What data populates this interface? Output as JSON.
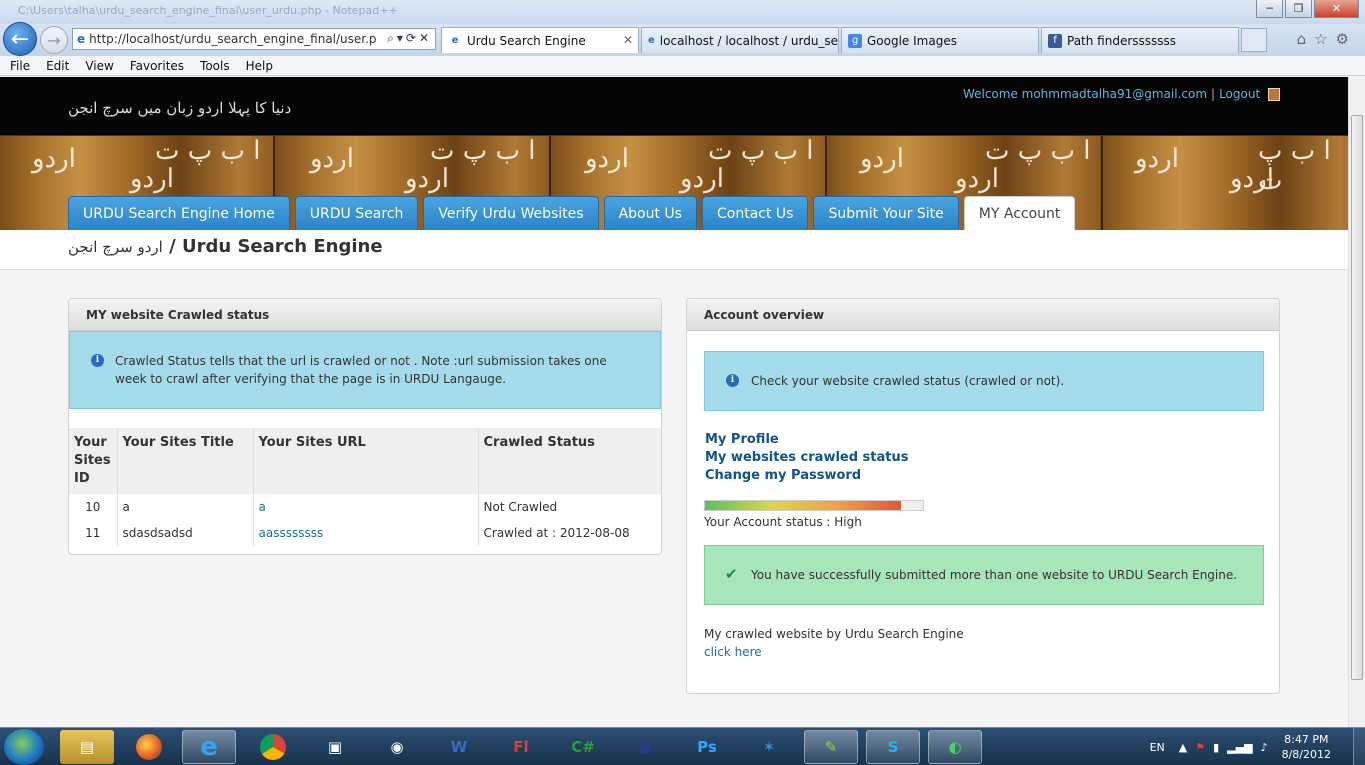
{
  "browser": {
    "title_text": "C:\\Users\\talha\\urdu_search_engine_final\\user_urdu.php - Notepad++",
    "address": "http://localhost/urdu_search_engine_final/user.p",
    "tabs": [
      {
        "label": "Urdu Search Engine",
        "active": true
      },
      {
        "label": "localhost / localhost / urdu_se...",
        "active": false
      },
      {
        "label": "Google Images",
        "active": false
      },
      {
        "label": "Path findersssssss",
        "active": false
      }
    ],
    "menu": [
      "File",
      "Edit",
      "View",
      "Favorites",
      "Tools",
      "Help"
    ]
  },
  "site": {
    "tagline": "دنیا کا پہلا اردو زبان میں سرچ انجن",
    "welcome": "Welcome mohmmadtalha91@gmail.com",
    "logout": "Logout",
    "banner_text": [
      "ا ب پ ت",
      "اردو"
    ],
    "nav": [
      "URDU Search Engine Home",
      "URDU Search",
      "Verify Urdu Websites",
      "About Us",
      "Contact Us",
      "Submit Your Site",
      "MY Account"
    ],
    "breadcrumb_urdu": "اردو سرچ انجن",
    "breadcrumb_sep": "/",
    "breadcrumb_title": "Urdu Search Engine"
  },
  "crawl_panel": {
    "title": "MY website Crawled status",
    "info": "Crawled Status tells that the url is crawled or not . Note :url submission takes one week to crawl after verifying that the page is in URDU Langauge.",
    "headers": [
      "Your Sites ID",
      "Your Sites Title",
      "Your Sites URL",
      "Crawled Status"
    ],
    "rows": [
      {
        "id": "10",
        "title": "a",
        "url": "a",
        "status": "Not Crawled"
      },
      {
        "id": "11",
        "title": "sdasdsadsd",
        "url": "aassssssss",
        "status": "Crawled at : 2012-08-08"
      }
    ]
  },
  "account_panel": {
    "title": "Account overview",
    "info": "Check your website crawled status (crawled or not).",
    "links": [
      "My Profile",
      "My websites crawled status",
      "Change my Password"
    ],
    "status_label": "Your Account status : High",
    "status_level": 0.9,
    "success": "You have successfully submitted more than one website to URDU Search Engine.",
    "crawled_text": "My crawled website by Urdu Search Engine",
    "click_here": "click here"
  },
  "taskbar": {
    "lang": "EN",
    "time": "8:47 PM",
    "date": "8/8/2012"
  }
}
